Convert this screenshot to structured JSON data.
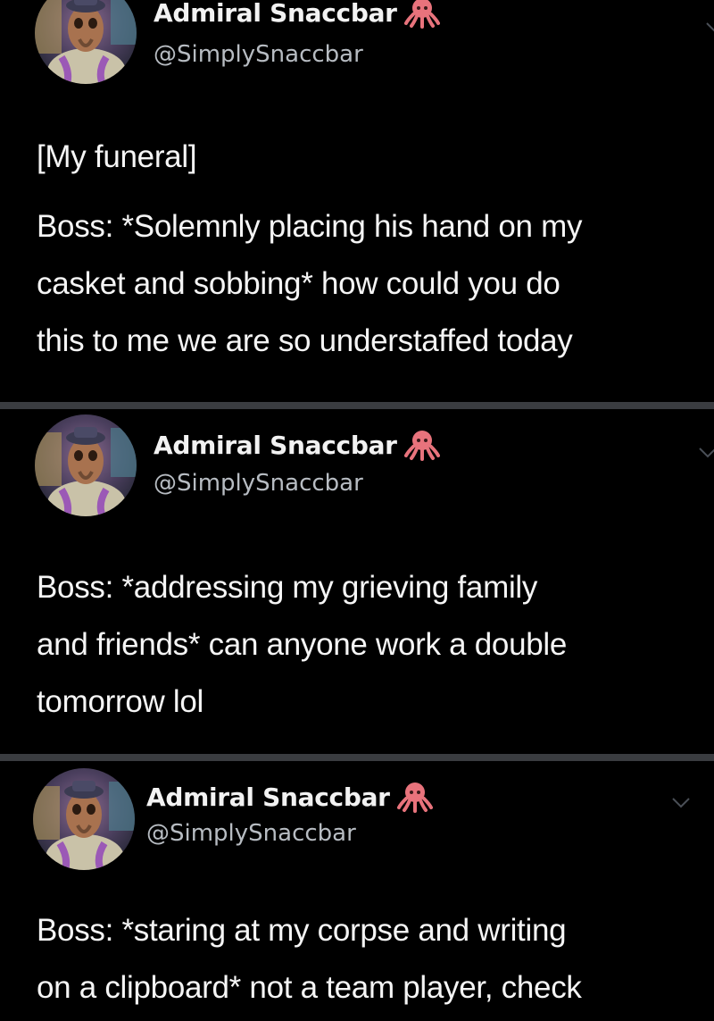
{
  "tweets": [
    {
      "display_name": "Admiral Snaccbar",
      "handle": "@SimplySnaccbar",
      "badge_icon": "octopus-icon",
      "lines": [
        "[My funeral]",
        "Boss: *Solemnly placing his hand on my",
        "casket and sobbing* how could you do",
        "this to me we are so understaffed today"
      ]
    },
    {
      "display_name": "Admiral Snaccbar",
      "handle": "@SimplySnaccbar",
      "badge_icon": "octopus-icon",
      "lines": [
        "Boss: *addressing my grieving family",
        "and friends* can anyone work a double",
        "tomorrow lol"
      ]
    },
    {
      "display_name": "Admiral Snaccbar",
      "handle": "@SimplySnaccbar",
      "badge_icon": "octopus-icon",
      "lines": [
        "Boss: *staring at my corpse and writing",
        "on a clipboard* not a team player, check"
      ]
    }
  ],
  "colors": {
    "background": "#000000",
    "divider": "#3a3c40",
    "text": "#f5f5f5",
    "handle": "#b7bcc2",
    "octopus": "#e8737c"
  }
}
